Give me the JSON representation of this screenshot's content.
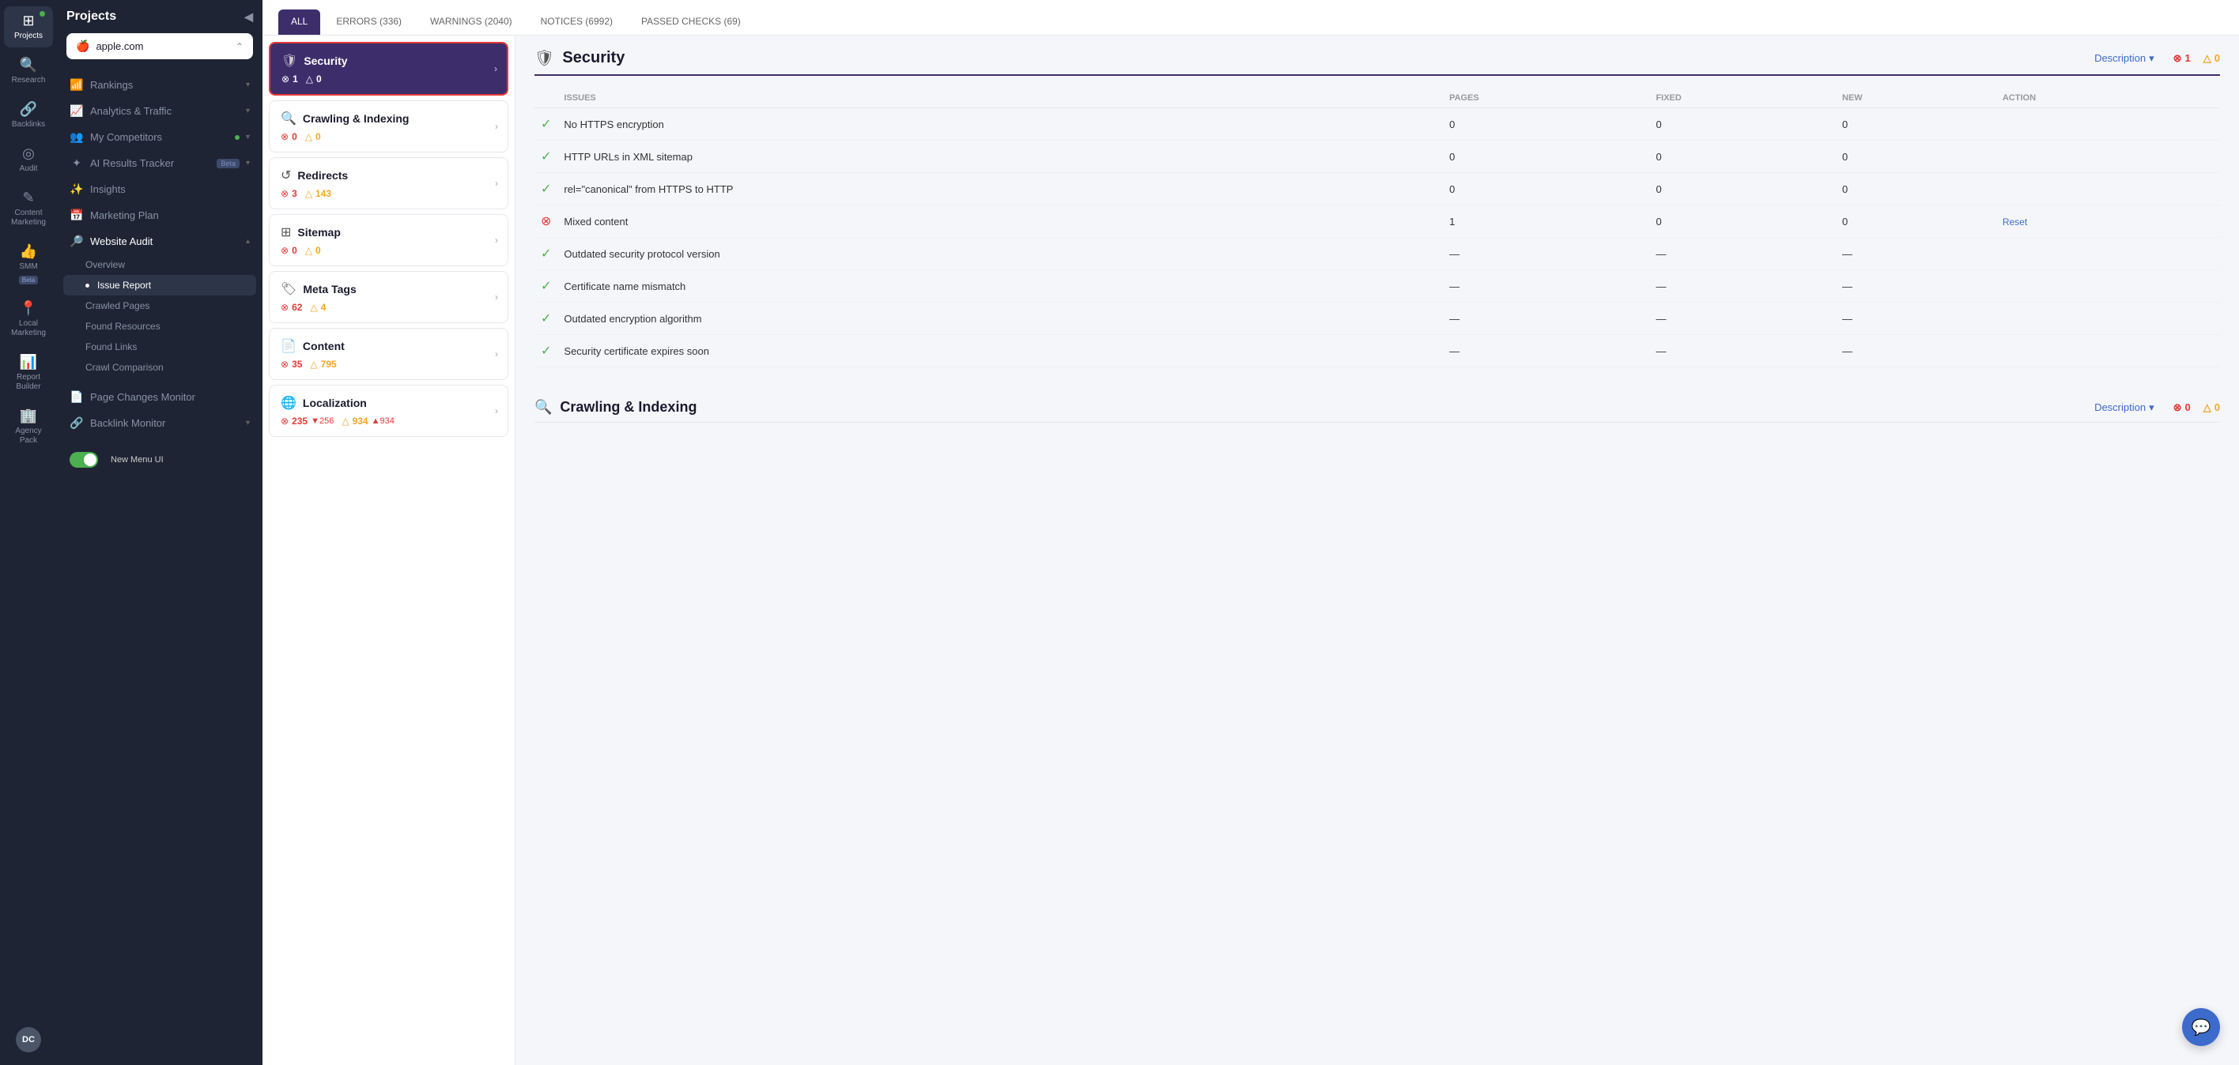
{
  "app": {
    "title": "Projects"
  },
  "icon_sidebar": {
    "items": [
      {
        "id": "projects",
        "label": "Projects",
        "icon": "⊞",
        "active": true,
        "has_dot": true
      },
      {
        "id": "research",
        "label": "Research",
        "icon": "🔍",
        "active": false
      },
      {
        "id": "backlinks",
        "label": "Backlinks",
        "icon": "🔗",
        "active": false
      },
      {
        "id": "audit",
        "label": "Audit",
        "icon": "◎",
        "active": false
      },
      {
        "id": "content-marketing",
        "label": "Content Marketing",
        "icon": "✎",
        "active": false
      },
      {
        "id": "smm",
        "label": "SMM",
        "icon": "👍",
        "active": false,
        "has_beta": true
      },
      {
        "id": "local-marketing",
        "label": "Local Marketing",
        "icon": "📍",
        "active": false
      },
      {
        "id": "report-builder",
        "label": "Report Builder",
        "icon": "📊",
        "active": false
      },
      {
        "id": "agency-pack",
        "label": "Agency Pack",
        "icon": "🏢",
        "active": false
      }
    ],
    "avatar": "DC"
  },
  "projects_sidebar": {
    "title": "Projects",
    "domain": "apple.com",
    "nav_items": [
      {
        "id": "rankings",
        "label": "Rankings",
        "icon": "📶",
        "has_chevron": true
      },
      {
        "id": "analytics-traffic",
        "label": "Analytics & Traffic",
        "icon": "📈",
        "has_chevron": true
      },
      {
        "id": "my-competitors",
        "label": "My Competitors",
        "icon": "👥",
        "has_chevron": true,
        "has_dot": true
      },
      {
        "id": "ai-results-tracker",
        "label": "AI Results Tracker",
        "icon": "✦",
        "has_chevron": true,
        "has_beta": true
      },
      {
        "id": "insights",
        "label": "Insights",
        "icon": "✨",
        "has_chevron": false
      },
      {
        "id": "marketing-plan",
        "label": "Marketing Plan",
        "icon": "📅",
        "has_chevron": false
      },
      {
        "id": "website-audit",
        "label": "Website Audit",
        "icon": "🔎",
        "has_chevron": true,
        "expanded": true
      }
    ],
    "sub_items": [
      {
        "id": "overview",
        "label": "Overview",
        "active": false
      },
      {
        "id": "issue-report",
        "label": "Issue Report",
        "active": true
      },
      {
        "id": "crawled-pages",
        "label": "Crawled Pages",
        "active": false
      },
      {
        "id": "found-resources",
        "label": "Found Resources",
        "active": false
      },
      {
        "id": "found-links",
        "label": "Found Links",
        "active": false
      },
      {
        "id": "crawl-comparison",
        "label": "Crawl Comparison",
        "active": false
      }
    ],
    "bottom_items": [
      {
        "id": "page-changes-monitor",
        "label": "Page Changes Monitor",
        "icon": "📄"
      },
      {
        "id": "backlink-monitor",
        "label": "Backlink Monitor",
        "icon": "🔗",
        "has_chevron": true
      }
    ]
  },
  "tabs": [
    {
      "id": "all",
      "label": "ALL",
      "active": true
    },
    {
      "id": "errors",
      "label": "ERRORS (336)",
      "active": false
    },
    {
      "id": "warnings",
      "label": "WARNINGS (2040)",
      "active": false
    },
    {
      "id": "notices",
      "label": "NOTICES (6992)",
      "active": false
    },
    {
      "id": "passed",
      "label": "PASSED CHECKS (69)",
      "active": false
    }
  ],
  "audit_cards": [
    {
      "id": "security",
      "icon": "🛡",
      "title": "Security",
      "errors": 1,
      "warnings": 0,
      "selected": true
    },
    {
      "id": "crawling-indexing",
      "icon": "🔍",
      "title": "Crawling & Indexing",
      "errors": 0,
      "warnings": 0,
      "selected": false
    },
    {
      "id": "redirects",
      "icon": "↺",
      "title": "Redirects",
      "errors": 3,
      "warnings": 143,
      "selected": false
    },
    {
      "id": "sitemap",
      "icon": "⊞",
      "title": "Sitemap",
      "errors": 0,
      "warnings": 0,
      "selected": false
    },
    {
      "id": "meta-tags",
      "icon": "🏷",
      "title": "Meta Tags",
      "errors": 62,
      "warnings": 4,
      "selected": false
    },
    {
      "id": "content",
      "icon": "📄",
      "title": "Content",
      "errors": 35,
      "warnings": 795,
      "selected": false
    },
    {
      "id": "localization",
      "icon": "🌐",
      "title": "Localization",
      "errors": 235,
      "errors_delta": "▼256",
      "warnings": 934,
      "warnings_delta": "▲934",
      "selected": false
    }
  ],
  "security_section": {
    "title": "Security",
    "description_label": "Description",
    "error_count": 1,
    "warning_count": 0,
    "columns": {
      "issues": "ISSUES",
      "pages": "PAGES",
      "fixed": "FIXED",
      "new": "NEW",
      "action": "ACTION"
    },
    "issues": [
      {
        "id": "no-https",
        "status": "ok",
        "name": "No HTTPS encryption",
        "pages": "0",
        "fixed": "0",
        "new": "0",
        "action": ""
      },
      {
        "id": "http-urls-xml",
        "status": "ok",
        "name": "HTTP URLs in XML sitemap",
        "pages": "0",
        "fixed": "0",
        "new": "0",
        "action": ""
      },
      {
        "id": "canonical-https-to-http",
        "status": "ok",
        "name": "rel=\"canonical\" from HTTPS to HTTP",
        "pages": "0",
        "fixed": "0",
        "new": "0",
        "action": ""
      },
      {
        "id": "mixed-content",
        "status": "error",
        "name": "Mixed content",
        "pages": "1",
        "fixed": "0",
        "new": "0",
        "action": "Reset"
      },
      {
        "id": "outdated-security-protocol",
        "status": "ok",
        "name": "Outdated security protocol version",
        "pages": "—",
        "fixed": "—",
        "new": "—",
        "action": ""
      },
      {
        "id": "certificate-name-mismatch",
        "status": "ok",
        "name": "Certificate name mismatch",
        "pages": "—",
        "fixed": "—",
        "new": "—",
        "action": ""
      },
      {
        "id": "outdated-encryption",
        "status": "ok",
        "name": "Outdated encryption algorithm",
        "pages": "—",
        "fixed": "—",
        "new": "—",
        "action": ""
      },
      {
        "id": "certificate-expires",
        "status": "ok",
        "name": "Security certificate expires soon",
        "pages": "—",
        "fixed": "—",
        "new": "—",
        "action": ""
      }
    ]
  },
  "crawling_section": {
    "title": "Crawling & Indexing",
    "description_label": "Description",
    "error_count": 0,
    "warning_count": 0
  },
  "chat_fab": {
    "label": "Chat"
  }
}
